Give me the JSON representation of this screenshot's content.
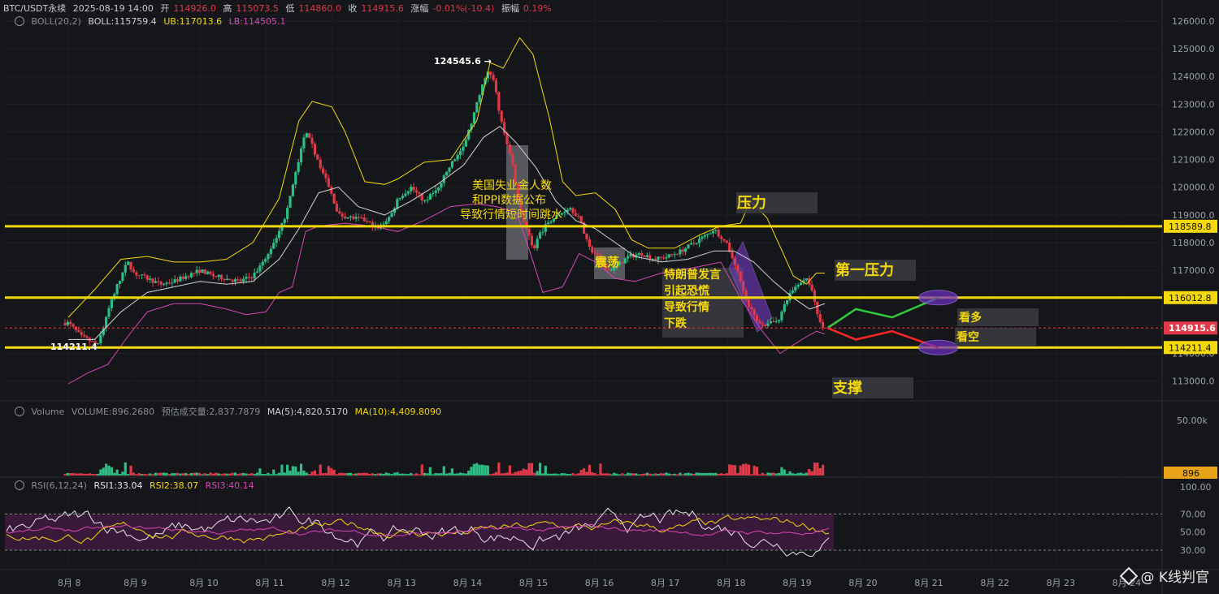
{
  "header": {
    "symbol": "BTC/USDT永续",
    "datetime": "2025-08-19 14:00",
    "open_label": "开",
    "open": "114926.0",
    "high_label": "高",
    "high": "115073.5",
    "low_label": "低",
    "low": "114860.0",
    "close_label": "收",
    "close": "114915.6",
    "change_label": "涨幅",
    "change": "-0.01%(-10.4)",
    "amp_label": "振幅",
    "amp": "0.19%"
  },
  "boll": {
    "name": "BOLL(20,2)",
    "mid": "BOLL:115759.4",
    "ub": "UB:117013.6",
    "lb": "LB:114505.1"
  },
  "volume_header": {
    "name": "Volume",
    "vol": "VOLUME:896.2680",
    "est": "预估成交量:2,837.7879",
    "ma5": "MA(5):4,820.5170",
    "ma10": "MA(10):4,409.8090"
  },
  "rsi_header": {
    "name": "RSI(6,12,24)",
    "r1": "RSI1:33.04",
    "r2": "RSI2:38.07",
    "r3": "RSI3:40.14"
  },
  "watermark": "@ K线判官",
  "colors": {
    "bg": "#151619",
    "up": "#2ebd85",
    "down": "#e0394a",
    "yellow": "#f5d90a",
    "pink": "#d946b5",
    "grey": "#cfd2d8",
    "purple": "#7b3fd1"
  },
  "chart_data": {
    "type": "candlestick",
    "title": "",
    "price_axis": {
      "min": 112500,
      "max": 126000,
      "ticks": [
        126000,
        125000,
        124000,
        123000,
        122000,
        121000,
        120000,
        119000,
        118000,
        117000,
        116000,
        115000,
        114000,
        113000
      ],
      "tick_labels": [
        "126000.0",
        "125000.0",
        "124000.0",
        "123000.0",
        "122000.0",
        "121000.0",
        "120000.0",
        "119000.0",
        "118000.0",
        "117000.0",
        "116000.0",
        "115000.0",
        "114000.0",
        "113000.0"
      ]
    },
    "x_axis": {
      "labels": [
        "8月 8",
        "8月 9",
        "8月 10",
        "8月 11",
        "8月 12",
        "8月 13",
        "8月 14",
        "8月 15",
        "8月 16",
        "8月 17",
        "8月 18",
        "8月 19",
        "8月 20",
        "8月 21",
        "8月 22",
        "8月 23",
        "8月 24"
      ]
    },
    "close_path": [
      [
        8.0,
        115100
      ],
      [
        8.2,
        114600
      ],
      [
        8.45,
        114300
      ],
      [
        8.6,
        115500
      ],
      [
        8.75,
        116500
      ],
      [
        8.9,
        117300
      ],
      [
        9.0,
        116900
      ],
      [
        9.2,
        116700
      ],
      [
        9.4,
        116500
      ],
      [
        9.6,
        116600
      ],
      [
        9.8,
        116800
      ],
      [
        10.0,
        117000
      ],
      [
        10.2,
        116800
      ],
      [
        10.4,
        116700
      ],
      [
        10.6,
        116600
      ],
      [
        10.8,
        116800
      ],
      [
        11.0,
        117400
      ],
      [
        11.15,
        118200
      ],
      [
        11.3,
        119000
      ],
      [
        11.5,
        121000
      ],
      [
        11.6,
        122000
      ],
      [
        11.7,
        121500
      ],
      [
        11.85,
        120600
      ],
      [
        12.0,
        119700
      ],
      [
        12.1,
        119000
      ],
      [
        12.3,
        118900
      ],
      [
        12.5,
        118800
      ],
      [
        12.7,
        118500
      ],
      [
        12.9,
        119000
      ],
      [
        13.0,
        119600
      ],
      [
        13.2,
        120000
      ],
      [
        13.4,
        119500
      ],
      [
        13.6,
        119900
      ],
      [
        13.8,
        120800
      ],
      [
        14.0,
        121500
      ],
      [
        14.1,
        122200
      ],
      [
        14.2,
        123000
      ],
      [
        14.35,
        124200
      ],
      [
        14.45,
        123900
      ],
      [
        14.55,
        122600
      ],
      [
        14.65,
        121600
      ],
      [
        14.75,
        120700
      ],
      [
        14.85,
        119200
      ],
      [
        14.95,
        118500
      ],
      [
        15.05,
        117700
      ],
      [
        15.15,
        118300
      ],
      [
        15.3,
        118800
      ],
      [
        15.45,
        119000
      ],
      [
        15.6,
        119300
      ],
      [
        15.75,
        118900
      ],
      [
        15.9,
        117800
      ],
      [
        16.0,
        117600
      ],
      [
        16.2,
        117000
      ],
      [
        16.35,
        117200
      ],
      [
        16.5,
        117500
      ],
      [
        16.7,
        117600
      ],
      [
        16.9,
        117400
      ],
      [
        17.1,
        117500
      ],
      [
        17.3,
        117700
      ],
      [
        17.5,
        118000
      ],
      [
        17.7,
        118300
      ],
      [
        17.8,
        118500
      ],
      [
        17.9,
        118200
      ],
      [
        18.0,
        117900
      ],
      [
        18.15,
        117000
      ],
      [
        18.3,
        115800
      ],
      [
        18.45,
        115200
      ],
      [
        18.6,
        115000
      ],
      [
        18.8,
        115300
      ],
      [
        18.95,
        116200
      ],
      [
        19.1,
        116600
      ],
      [
        19.2,
        116700
      ],
      [
        19.3,
        116200
      ],
      [
        19.4,
        115100
      ],
      [
        19.48,
        114900
      ]
    ],
    "bollinger": {
      "upper": [
        [
          8.0,
          115300
        ],
        [
          8.4,
          116300
        ],
        [
          8.8,
          117400
        ],
        [
          9.2,
          117500
        ],
        [
          9.6,
          117300
        ],
        [
          10.0,
          117300
        ],
        [
          10.4,
          117400
        ],
        [
          10.8,
          118000
        ],
        [
          11.2,
          119600
        ],
        [
          11.5,
          122400
        ],
        [
          11.7,
          123100
        ],
        [
          12.0,
          122900
        ],
        [
          12.2,
          122000
        ],
        [
          12.5,
          120200
        ],
        [
          12.8,
          120100
        ],
        [
          13.0,
          120300
        ],
        [
          13.4,
          120900
        ],
        [
          13.8,
          121000
        ],
        [
          14.2,
          122400
        ],
        [
          14.4,
          124500
        ],
        [
          14.6,
          124300
        ],
        [
          14.85,
          125400
        ],
        [
          15.05,
          124800
        ],
        [
          15.3,
          122500
        ],
        [
          15.5,
          120200
        ],
        [
          15.7,
          119700
        ],
        [
          16.0,
          119800
        ],
        [
          16.3,
          119200
        ],
        [
          16.55,
          118100
        ],
        [
          16.8,
          117800
        ],
        [
          17.2,
          117800
        ],
        [
          17.6,
          118300
        ],
        [
          17.9,
          118600
        ],
        [
          18.2,
          118700
        ],
        [
          18.35,
          119500
        ],
        [
          18.6,
          118900
        ],
        [
          18.85,
          117600
        ],
        [
          19.0,
          116800
        ],
        [
          19.2,
          116500
        ],
        [
          19.35,
          116900
        ],
        [
          19.48,
          116900
        ]
      ],
      "middle": [
        [
          8.0,
          114500
        ],
        [
          8.4,
          114500
        ],
        [
          8.8,
          115500
        ],
        [
          9.2,
          116200
        ],
        [
          9.6,
          116400
        ],
        [
          10.0,
          116600
        ],
        [
          10.4,
          116500
        ],
        [
          10.8,
          116600
        ],
        [
          11.2,
          117400
        ],
        [
          11.5,
          118500
        ],
        [
          11.8,
          119800
        ],
        [
          12.1,
          120000
        ],
        [
          12.4,
          119300
        ],
        [
          12.8,
          119000
        ],
        [
          13.2,
          119500
        ],
        [
          13.6,
          120100
        ],
        [
          14.0,
          120800
        ],
        [
          14.3,
          121800
        ],
        [
          14.55,
          122200
        ],
        [
          14.8,
          121600
        ],
        [
          15.1,
          120700
        ],
        [
          15.4,
          119500
        ],
        [
          15.7,
          118800
        ],
        [
          16.0,
          118500
        ],
        [
          16.3,
          118000
        ],
        [
          16.6,
          117500
        ],
        [
          17.0,
          117300
        ],
        [
          17.4,
          117400
        ],
        [
          17.8,
          117700
        ],
        [
          18.1,
          117700
        ],
        [
          18.4,
          117300
        ],
        [
          18.7,
          116600
        ],
        [
          19.0,
          116000
        ],
        [
          19.25,
          115600
        ],
        [
          19.48,
          115800
        ]
      ],
      "lower": [
        [
          8.0,
          112900
        ],
        [
          8.3,
          113300
        ],
        [
          8.6,
          113600
        ],
        [
          8.9,
          114600
        ],
        [
          9.2,
          115500
        ],
        [
          9.6,
          115800
        ],
        [
          10.0,
          115800
        ],
        [
          10.4,
          115600
        ],
        [
          10.7,
          115400
        ],
        [
          11.0,
          115500
        ],
        [
          11.2,
          116200
        ],
        [
          11.4,
          116400
        ],
        [
          11.6,
          118400
        ],
        [
          11.8,
          118600
        ],
        [
          12.2,
          118700
        ],
        [
          12.6,
          118600
        ],
        [
          13.0,
          118400
        ],
        [
          13.4,
          118800
        ],
        [
          13.8,
          119300
        ],
        [
          14.2,
          119400
        ],
        [
          14.5,
          119300
        ],
        [
          14.8,
          119100
        ],
        [
          15.0,
          117700
        ],
        [
          15.2,
          116200
        ],
        [
          15.5,
          116400
        ],
        [
          15.75,
          117600
        ],
        [
          16.0,
          117300
        ],
        [
          16.3,
          116700
        ],
        [
          16.6,
          116600
        ],
        [
          17.0,
          116900
        ],
        [
          17.5,
          117100
        ],
        [
          17.9,
          117300
        ],
        [
          18.2,
          116000
        ],
        [
          18.5,
          114900
        ],
        [
          18.8,
          114000
        ],
        [
          19.0,
          114300
        ],
        [
          19.2,
          114600
        ],
        [
          19.35,
          114800
        ],
        [
          19.48,
          114700
        ]
      ]
    },
    "horizontal_levels": [
      {
        "price": 118589.8,
        "label": "118589.8"
      },
      {
        "price": 116012.8,
        "label": "116012.8"
      },
      {
        "price": 114211.4,
        "label": "114211.4"
      }
    ],
    "current_price": {
      "price": 114915.6,
      "label": "114915.6"
    },
    "annotations": {
      "high_marker": "124545.6",
      "low_marker": "114211.4",
      "ppi_note": [
        "美国失业金人数",
        "和PPI数据公布",
        "导致行情短时间跳水"
      ],
      "range_note": "震荡",
      "trump_note": [
        "特朗普发言",
        "引起恐慌",
        "导致行情",
        "下跌"
      ],
      "pressure": "压力",
      "first_pressure": "第一压力",
      "support": "支撑",
      "bull": "看多",
      "bear": "看空"
    },
    "scenarios": {
      "bull_path": [
        [
          19.52,
          114915.6
        ],
        [
          19.95,
          115600
        ],
        [
          20.5,
          115300
        ],
        [
          21.2,
          116012.8
        ]
      ],
      "bear_path": [
        [
          19.52,
          114915.6
        ],
        [
          19.95,
          114500
        ],
        [
          20.5,
          114800
        ],
        [
          21.2,
          114211.4
        ]
      ]
    },
    "volume": {
      "axis_label": "50.00k",
      "current_label": "896",
      "max": 60000
    },
    "rsi": {
      "ticks": [
        "100.00",
        "70.00",
        "50.00",
        "30.00"
      ],
      "upper": 70,
      "lower": 30
    }
  }
}
